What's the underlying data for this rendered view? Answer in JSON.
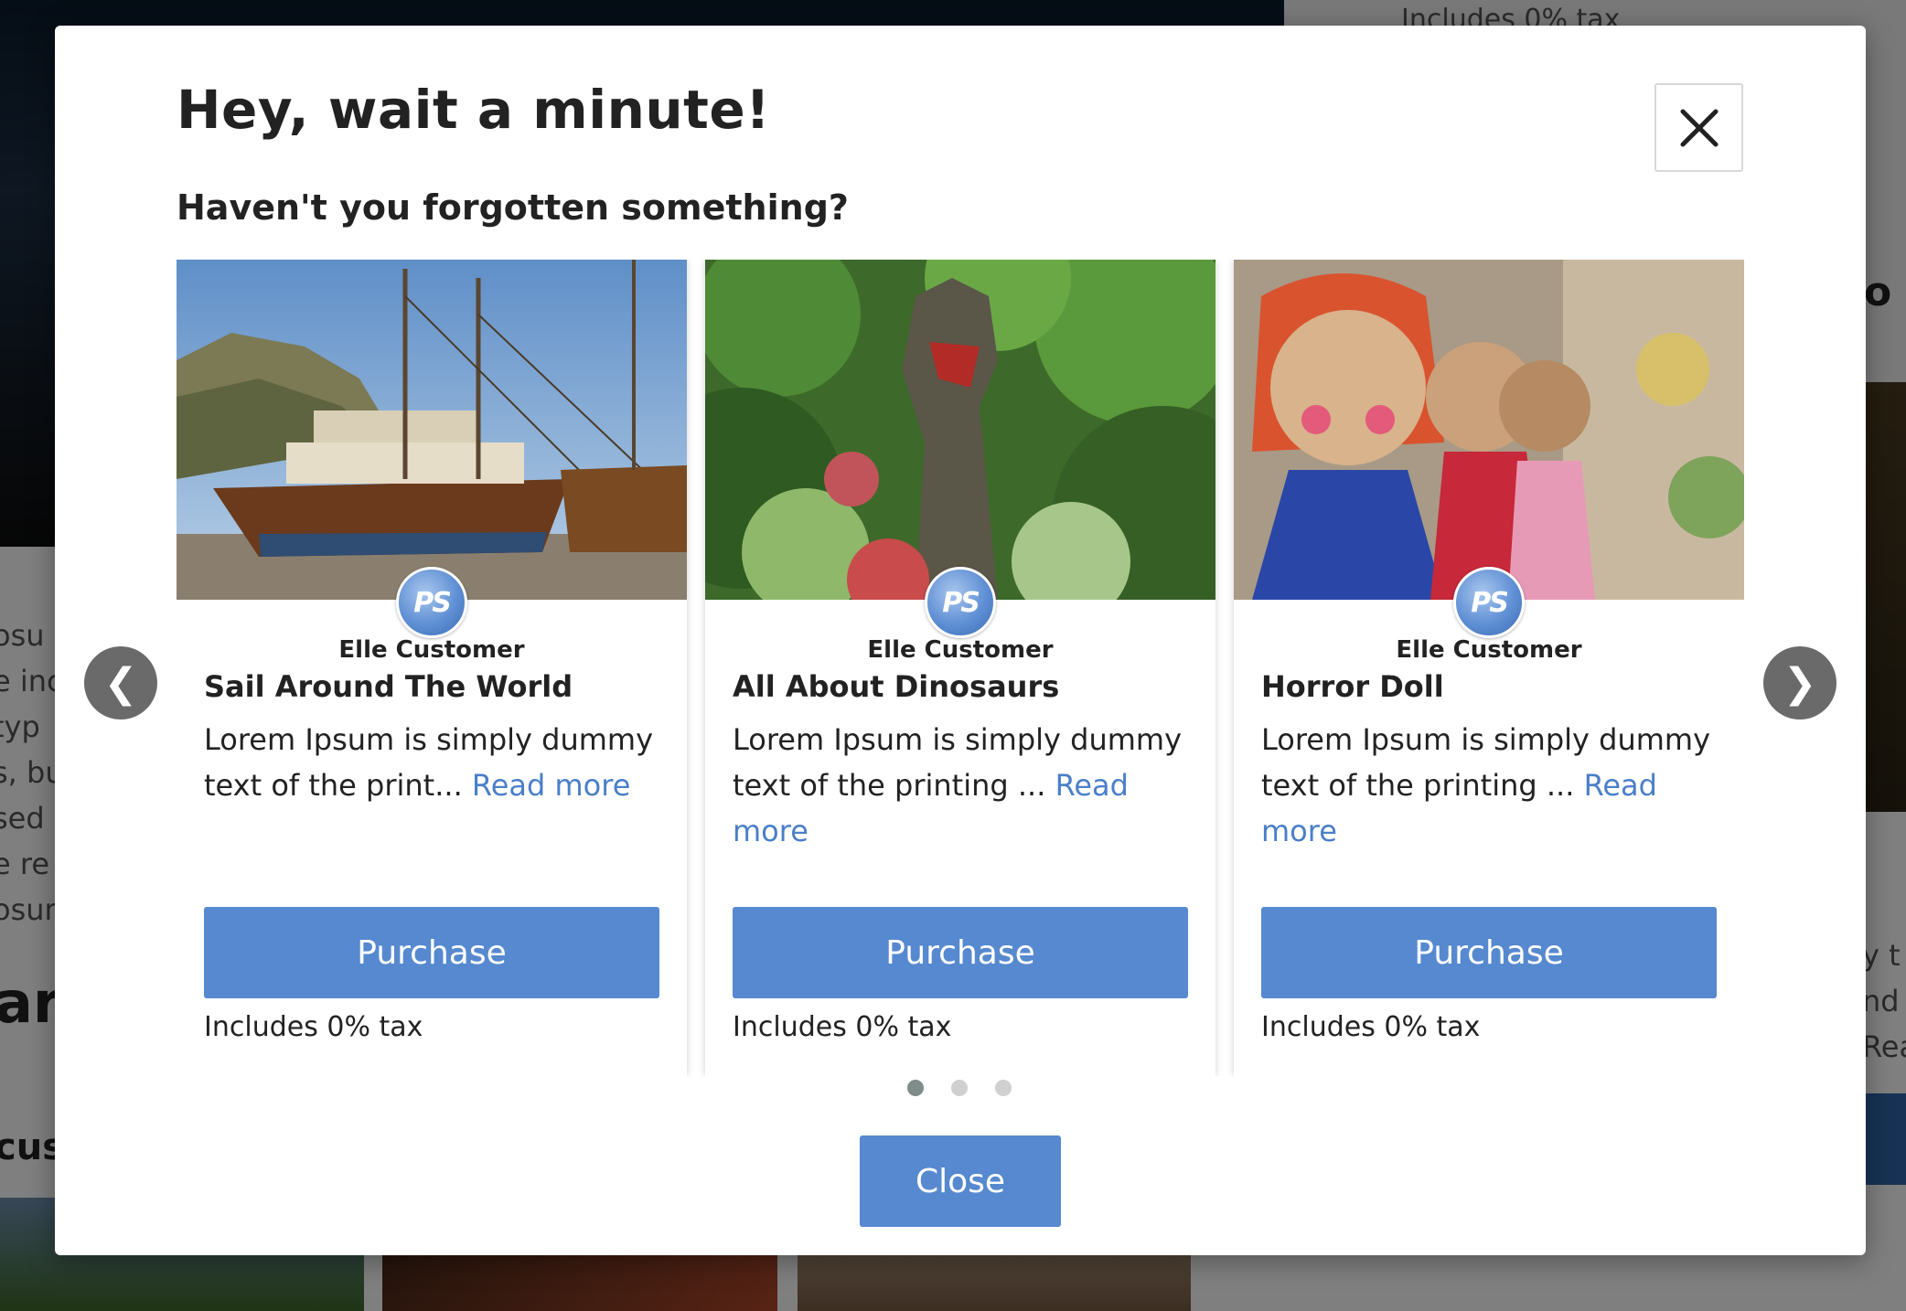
{
  "background": {
    "tax_text": "Includes 0% tax",
    "left_fragments": "osu\ne inc\ntyp\ns, bu\nsed\ne re\nosun",
    "left_heading_fragment": "ar",
    "left_subheading_fragment": "cus",
    "right_heading_fragment": "o",
    "right_fragments": "y t\nnd\nRea"
  },
  "modal": {
    "title": "Hey, wait a minute!",
    "subtitle": "Haven't you forgotten something?",
    "close_icon": "close-icon",
    "prev_arrow": "❮",
    "next_arrow": "❯",
    "close_button_label": "Close",
    "dots": {
      "count": 3,
      "active_index": 0
    },
    "accent_color": "#5689cf",
    "link_color": "#4a7fc9"
  },
  "products": [
    {
      "author": "Elle Customer",
      "avatar_text": "PS",
      "title": "Sail Around The World",
      "description": "Lorem Ipsum is simply dummy text of the print...",
      "read_more": "Read more",
      "purchase_label": "Purchase",
      "tax": "Includes 0% tax",
      "image": "sailing-ship"
    },
    {
      "author": "Elle Customer",
      "avatar_text": "PS",
      "title": "All About Dinosaurs",
      "description": "Lorem Ipsum is simply dummy text of the printing ...",
      "read_more": "Read more",
      "purchase_label": "Purchase",
      "tax": "Includes 0% tax",
      "image": "dinosaur-statue"
    },
    {
      "author": "Elle Customer",
      "avatar_text": "PS",
      "title": "Horror Doll",
      "description": "Lorem Ipsum is simply dummy text of the printing ...",
      "read_more": "Read more",
      "purchase_label": "Purchase",
      "tax": "Includes 0% tax",
      "image": "crochet-dolls"
    }
  ]
}
